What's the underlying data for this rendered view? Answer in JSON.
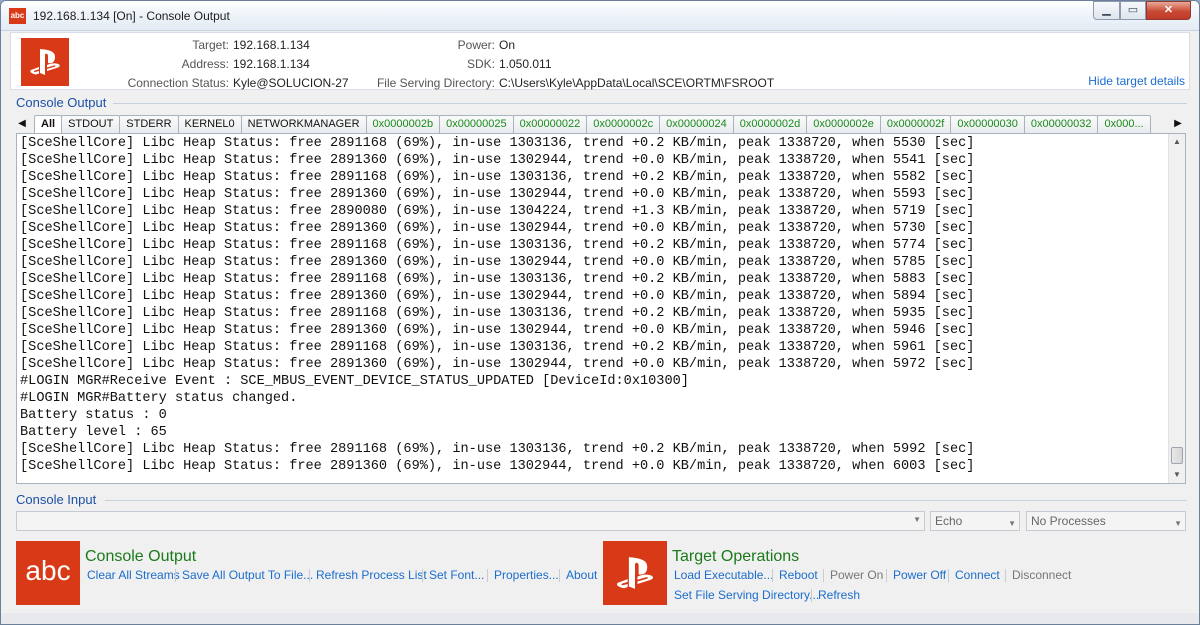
{
  "window": {
    "title": "192.168.1.134 [On] - Console Output",
    "icon_text": "abc",
    "controls": {
      "minimize": "▁",
      "maximize": "▭",
      "close": "✕"
    }
  },
  "header": {
    "target_label": "Target:",
    "target_value": "192.168.1.134",
    "address_label": "Address:",
    "address_value": "192.168.1.134",
    "status_label": "Connection Status:",
    "status_value": "Kyle@SOLUCION-27",
    "power_label": "Power:",
    "power_value": "On",
    "sdk_label": "SDK:",
    "sdk_value": "1.050.011",
    "fsd_label": "File Serving Directory:",
    "fsd_value": "C:\\Users\\Kyle\\AppData\\Local\\SCE\\ORTM\\FSROOT",
    "hide_link": "Hide target details"
  },
  "console_output": {
    "group_title": "Console Output",
    "tabs": [
      {
        "label": "All",
        "active": true
      },
      {
        "label": "STDOUT"
      },
      {
        "label": "STDERR"
      },
      {
        "label": "KERNEL0"
      },
      {
        "label": "NETWORKMANAGER"
      },
      {
        "label": "0x0000002b",
        "proc": true
      },
      {
        "label": "0x00000025",
        "proc": true
      },
      {
        "label": "0x00000022",
        "proc": true
      },
      {
        "label": "0x0000002c",
        "proc": true
      },
      {
        "label": "0x00000024",
        "proc": true
      },
      {
        "label": "0x0000002d",
        "proc": true
      },
      {
        "label": "0x0000002e",
        "proc": true
      },
      {
        "label": "0x0000002f",
        "proc": true
      },
      {
        "label": "0x00000030",
        "proc": true
      },
      {
        "label": "0x00000032",
        "proc": true
      },
      {
        "label": "0x000...",
        "proc": true
      }
    ],
    "lines": [
      "[SceShellCore] Libc Heap Status: free 2891168 (69%), in-use 1303136, trend +0.2 KB/min, peak 1338720, when 5530 [sec]",
      "[SceShellCore] Libc Heap Status: free 2891360 (69%), in-use 1302944, trend +0.0 KB/min, peak 1338720, when 5541 [sec]",
      "[SceShellCore] Libc Heap Status: free 2891168 (69%), in-use 1303136, trend +0.2 KB/min, peak 1338720, when 5582 [sec]",
      "[SceShellCore] Libc Heap Status: free 2891360 (69%), in-use 1302944, trend +0.0 KB/min, peak 1338720, when 5593 [sec]",
      "[SceShellCore] Libc Heap Status: free 2890080 (69%), in-use 1304224, trend +1.3 KB/min, peak 1338720, when 5719 [sec]",
      "[SceShellCore] Libc Heap Status: free 2891360 (69%), in-use 1302944, trend +0.0 KB/min, peak 1338720, when 5730 [sec]",
      "[SceShellCore] Libc Heap Status: free 2891168 (69%), in-use 1303136, trend +0.2 KB/min, peak 1338720, when 5774 [sec]",
      "[SceShellCore] Libc Heap Status: free 2891360 (69%), in-use 1302944, trend +0.0 KB/min, peak 1338720, when 5785 [sec]",
      "[SceShellCore] Libc Heap Status: free 2891168 (69%), in-use 1303136, trend +0.2 KB/min, peak 1338720, when 5883 [sec]",
      "[SceShellCore] Libc Heap Status: free 2891360 (69%), in-use 1302944, trend +0.0 KB/min, peak 1338720, when 5894 [sec]",
      "[SceShellCore] Libc Heap Status: free 2891168 (69%), in-use 1303136, trend +0.2 KB/min, peak 1338720, when 5935 [sec]",
      "[SceShellCore] Libc Heap Status: free 2891360 (69%), in-use 1302944, trend +0.0 KB/min, peak 1338720, when 5946 [sec]",
      "[SceShellCore] Libc Heap Status: free 2891168 (69%), in-use 1303136, trend +0.2 KB/min, peak 1338720, when 5961 [sec]",
      "[SceShellCore] Libc Heap Status: free 2891360 (69%), in-use 1302944, trend +0.0 KB/min, peak 1338720, when 5972 [sec]",
      "#LOGIN MGR#Receive Event : SCE_MBUS_EVENT_DEVICE_STATUS_UPDATED [DeviceId:0x10300]",
      "#LOGIN MGR#Battery status changed.",
      "Battery status : 0",
      "Battery level : 65",
      "[SceShellCore] Libc Heap Status: free 2891168 (69%), in-use 1303136, trend +0.2 KB/min, peak 1338720, when 5992 [sec]",
      "[SceShellCore] Libc Heap Status: free 2891360 (69%), in-use 1302944, trend +0.0 KB/min, peak 1338720, when 6003 [sec]"
    ]
  },
  "console_input": {
    "group_title": "Console Input",
    "input_value": "",
    "echo_value": "Echo",
    "processes_value": "No Processes"
  },
  "panels": {
    "console": {
      "icon_text": "abc",
      "title": "Console Output",
      "links": [
        "Clear All Streams",
        "Save All Output To File...",
        "Refresh Process List",
        "Set Font...",
        "Properties...",
        "About"
      ]
    },
    "target": {
      "title": "Target Operations",
      "row1": [
        {
          "label": "Load Executable..."
        },
        {
          "label": "Reboot"
        },
        {
          "label": "Power On",
          "disabled": true
        },
        {
          "label": "Power Off"
        },
        {
          "label": "Connect"
        },
        {
          "label": "Disconnect",
          "disabled": true
        }
      ],
      "row2": [
        "Set File Serving Directory...",
        "Refresh"
      ]
    }
  },
  "colors": {
    "accent_red": "#d83a17",
    "link_blue": "#1c6dcc",
    "group_blue": "#1c50a6",
    "panel_green": "#1b7a1b"
  }
}
